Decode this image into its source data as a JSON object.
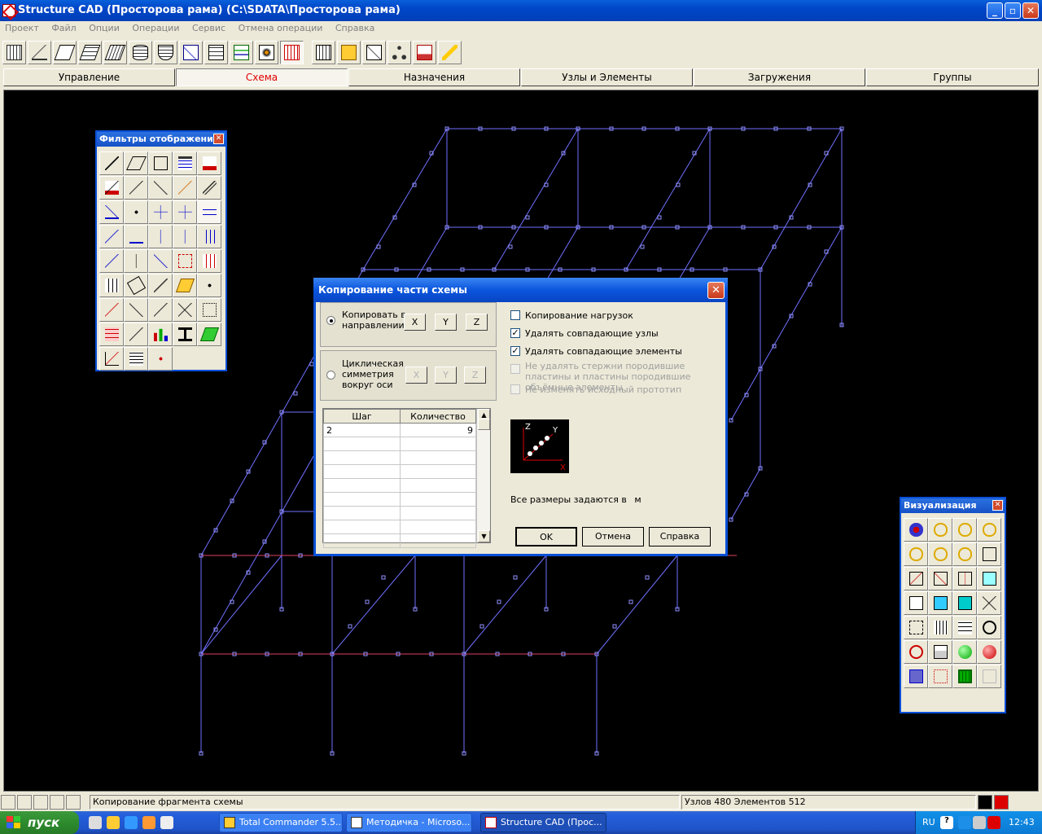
{
  "window": {
    "title": "Structure CAD (Просторова рама) (C:\\SDATA\\Просторова рама)",
    "minimize": "_",
    "maximize": "▫",
    "close": "✕"
  },
  "menu": [
    "Проект",
    "Файл",
    "Опции",
    "Операции",
    "Сервис",
    "Отмена операции",
    "Справка"
  ],
  "tabs": [
    {
      "label": "Управление",
      "active": false
    },
    {
      "label": "Схема",
      "active": true
    },
    {
      "label": "Назначения",
      "active": false
    },
    {
      "label": "Узлы и Элементы",
      "active": false
    },
    {
      "label": "Загружения",
      "active": false
    },
    {
      "label": "Группы",
      "active": false
    }
  ],
  "filters_palette": {
    "title": "Фильтры отображения",
    "close": "✕"
  },
  "visual_palette": {
    "title": "Визуализация",
    "close": "✕"
  },
  "dialog": {
    "title": "Копирование части схемы",
    "close": "✕",
    "copy_direction_label": "Копировать в направлении",
    "cyclic_label": "Циклическая симметрия вокруг оси",
    "axis_x": "X",
    "axis_y": "Y",
    "axis_z": "Z",
    "opt_copy_loads": "Копирование нагрузок",
    "opt_delete_nodes": "Удалять совпадающие узлы",
    "opt_delete_elements": "Удалять совпадающие элементы",
    "opt_keep_bars": "Не удалять стержни породившие пластины и пластины породившие объёмные элементы",
    "opt_keep_prototype": "Не изменять исходный прототип",
    "table_headers": {
      "step": "Шаг",
      "count": "Количество"
    },
    "table_rows": [
      {
        "step": "2",
        "count": "9"
      }
    ],
    "units_text": "Все размеры задаются в",
    "units": "м",
    "preview_axes": {
      "z": "Z",
      "y": "Y",
      "x": "X"
    },
    "ok": "OK",
    "cancel": "Отмена",
    "help": "Справка"
  },
  "status": {
    "message": "Копирование фрагмента схемы",
    "counts": "Узлов 480 Элементов 512"
  },
  "taskbar": {
    "start": "пуск",
    "tasks": [
      "Total Commander 5.5...",
      "Методичка - Microso...",
      "Structure CAD (Прос..."
    ],
    "lang": "RU",
    "time": "12:43"
  }
}
